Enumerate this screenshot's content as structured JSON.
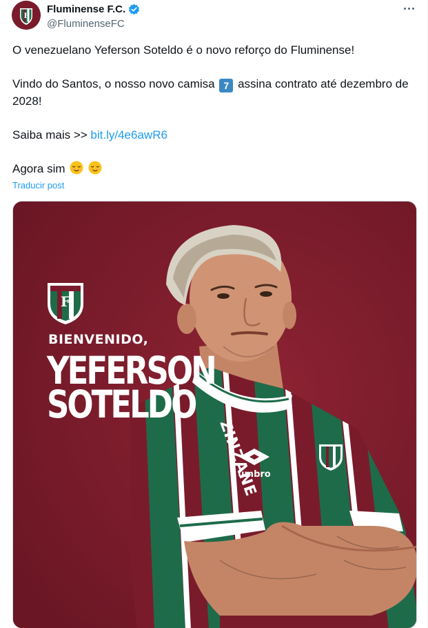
{
  "post": {
    "author_name": "Fluminense F.C.",
    "handle": "@FluminenseFC",
    "verified": true,
    "avatar_icon": "fluminense-crest-icon",
    "more_icon": "more-options-icon",
    "line1": "O venezuelano Yeferson Soteldo é o novo reforço do Fluminense!",
    "line2_before": "Vindo do Santos, o nosso novo camisa",
    "shirt_number": "7",
    "line2_after": "assina contrato até dezembro de 2028!",
    "line3_prefix": "Saiba mais >>",
    "link_text": "bit.ly/4e6awR6",
    "line4": "Agora sim",
    "emoji_icon": "relieved-face-emoji",
    "translate_label": "Traducir post"
  },
  "media": {
    "welcome": "BIENVENIDO,",
    "first_name": "YEFERSON",
    "last_name": "SOTELDO",
    "jersey_sponsor": "ZINZANE",
    "jersey_brand": "umbro"
  },
  "colors": {
    "accent": "#1d9bf0",
    "text": "#0f1419",
    "secondary": "#536471",
    "media_bg": "#7a1c2a",
    "stripe_green": "#1e6b4a",
    "stripe_maroon": "#7a1b2b"
  }
}
